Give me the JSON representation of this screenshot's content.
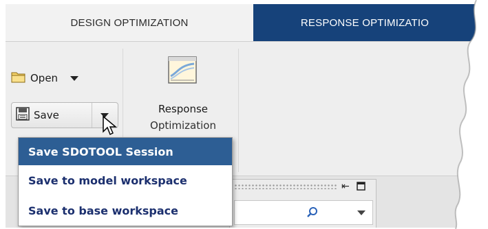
{
  "tabs": [
    {
      "label": "DESIGN OPTIMIZATION",
      "active": true
    },
    {
      "label": "RESPONSE OPTIMIZATIO",
      "active": false
    }
  ],
  "toolbar": {
    "open_label": "Open",
    "save_label": "Save",
    "response_label_line1": "Response",
    "response_label_line2": "Optimization"
  },
  "save_menu": {
    "items": [
      {
        "label": "Save SDOTOOL Session",
        "selected": true
      },
      {
        "label": "Save to model workspace",
        "selected": false
      },
      {
        "label": "Save to base workspace",
        "selected": false
      }
    ]
  },
  "colors": {
    "tab_bar": "#16427a",
    "menu_selected": "#2d5e94",
    "menu_text": "#1b2f6e"
  },
  "icons": [
    "folder-icon",
    "floppy-disk-icon",
    "response-optimization-icon",
    "search-icon",
    "undock-icon",
    "maximize-icon",
    "mouse-pointer-icon"
  ]
}
